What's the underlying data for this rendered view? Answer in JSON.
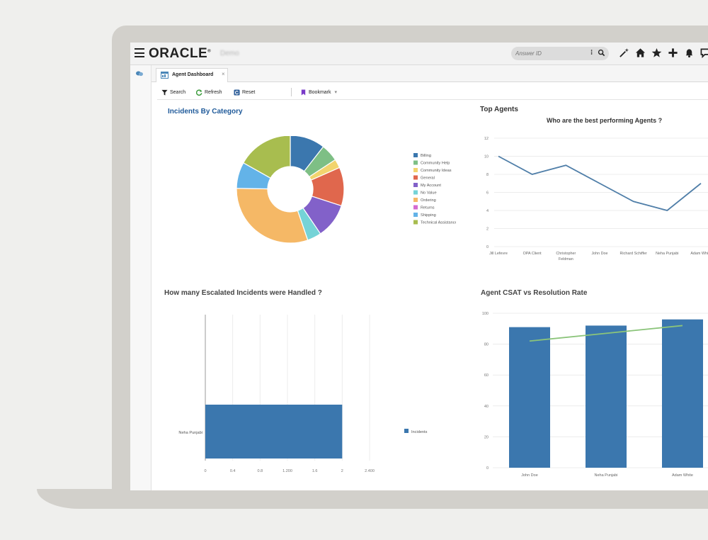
{
  "header": {
    "logo": "ORACLE",
    "logo_mark": "®",
    "subtitle": "Demo",
    "search_placeholder": "Answer ID",
    "search_menu": "⁝",
    "icons": [
      "magic-wand-icon",
      "home-icon",
      "star-icon",
      "plus-icon",
      "bell-icon",
      "chat-icon"
    ]
  },
  "tab": {
    "label": "Agent Dashboard",
    "close": "×"
  },
  "toolbar": {
    "search": "Search",
    "refresh": "Refresh",
    "reset": "Reset",
    "bookmark": "Bookmark",
    "bookmark_caret": "▾"
  },
  "panels": {
    "incidents_by_category": "Incidents By Category",
    "top_agents": "Top Agents",
    "top_agents_subtitle": "Who are the best performing Agents ?",
    "escalated": "How many Escalated Incidents were Handled ?",
    "csat": "Agent CSAT vs Resolution Rate"
  },
  "colors": {
    "accent": "#3b77ae",
    "title_blue": "#1f5a9a",
    "line_green": "#8bc47a"
  },
  "chart_data": [
    {
      "type": "pie",
      "title": "Incidents By Category",
      "donut": true,
      "legend": "right",
      "categories": [
        "Billing",
        "Community Help",
        "Community Ideas",
        "General",
        "My Account",
        "No Value",
        "Ordering",
        "Returns",
        "Shipping",
        "Technical Assistance"
      ],
      "values": [
        10,
        5,
        2.5,
        11,
        10,
        4,
        29,
        0,
        7.5,
        16
      ],
      "colors": [
        "#3b77ae",
        "#7ebf85",
        "#f2d46e",
        "#e0674d",
        "#8261c9",
        "#75d3d7",
        "#f5b866",
        "#d46bd0",
        "#63b3e8",
        "#a8bd4f"
      ]
    },
    {
      "type": "line",
      "title": "Top Agents",
      "subtitle": "Who are the best performing Agents ?",
      "categories": [
        "Jill Lefevre",
        "OPA Client",
        "Christopher Feldman",
        "John Doe",
        "Richard Schiffer",
        "Neha Punjabi",
        "Adam White"
      ],
      "category_lines": [
        [
          "Jill Lefevre"
        ],
        [
          "OPA Client"
        ],
        [
          "Christopher",
          "Feldman"
        ],
        [
          "John Doe"
        ],
        [
          "Richard Schiffer"
        ],
        [
          "Neha Punjabi"
        ],
        [
          "Adam White"
        ]
      ],
      "values": [
        10,
        8,
        9,
        7,
        5,
        4,
        7
      ],
      "ylim": [
        0,
        12
      ],
      "yticks": [
        "0",
        "2",
        "4",
        "6",
        "8",
        "10",
        "12"
      ],
      "grid": true,
      "color": "#4f7ea8"
    },
    {
      "type": "bar",
      "orientation": "horizontal",
      "title": "How many Escalated Incidents were Handled ?",
      "categories": [
        "Neha Punjabi"
      ],
      "series": [
        {
          "name": "Incidents",
          "values": [
            2
          ]
        }
      ],
      "xlim": [
        0,
        2.4
      ],
      "xticks": [
        "0",
        "0.4",
        "0.8",
        "1.200",
        "1.6",
        "2",
        "2.400"
      ],
      "legend": "right",
      "color": "#3b77ae"
    },
    {
      "type": "bar",
      "title": "Agent CSAT vs Resolution Rate",
      "categories": [
        "John Doe",
        "Neha Punjabi",
        "Adam White"
      ],
      "bars": [
        91,
        92,
        96
      ],
      "line": [
        82,
        87,
        92
      ],
      "ylim": [
        0,
        100
      ],
      "yticks": [
        "0",
        "20",
        "40",
        "60",
        "80",
        "100"
      ],
      "grid": true,
      "bar_color": "#3b77ae",
      "line_color": "#8bc47a"
    }
  ]
}
